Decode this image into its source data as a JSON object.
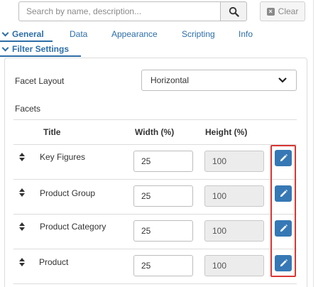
{
  "search": {
    "placeholder": "Search by name, description...",
    "value": "",
    "clear_label": "Clear"
  },
  "tabs": [
    {
      "label": "General",
      "active": true
    },
    {
      "label": "Data",
      "active": false
    },
    {
      "label": "Appearance",
      "active": false
    },
    {
      "label": "Scripting",
      "active": false
    },
    {
      "label": "Info",
      "active": false
    }
  ],
  "section": {
    "title": "Filter Settings",
    "expanded": true
  },
  "facet_layout": {
    "label": "Facet Layout",
    "value": "Horizontal"
  },
  "facets": {
    "label": "Facets",
    "columns": {
      "title": "Title",
      "width": "Width (%)",
      "height": "Height (%)"
    },
    "rows": [
      {
        "title": "Key Figures",
        "width": "25",
        "height": "100"
      },
      {
        "title": "Product Group",
        "width": "25",
        "height": "100"
      },
      {
        "title": "Product Category",
        "width": "25",
        "height": "100"
      },
      {
        "title": "Product",
        "width": "25",
        "height": "100"
      }
    ]
  },
  "colors": {
    "accent": "#2d6ea8",
    "edit_button": "#3678b5",
    "highlight_border": "#d93636"
  },
  "icons": {
    "search": "search-icon",
    "clear": "close-icon",
    "tab_chevron": "chevron-down-icon",
    "select": "chevron-down-icon",
    "drag": "drag-handle-icon",
    "edit": "pencil-icon"
  }
}
